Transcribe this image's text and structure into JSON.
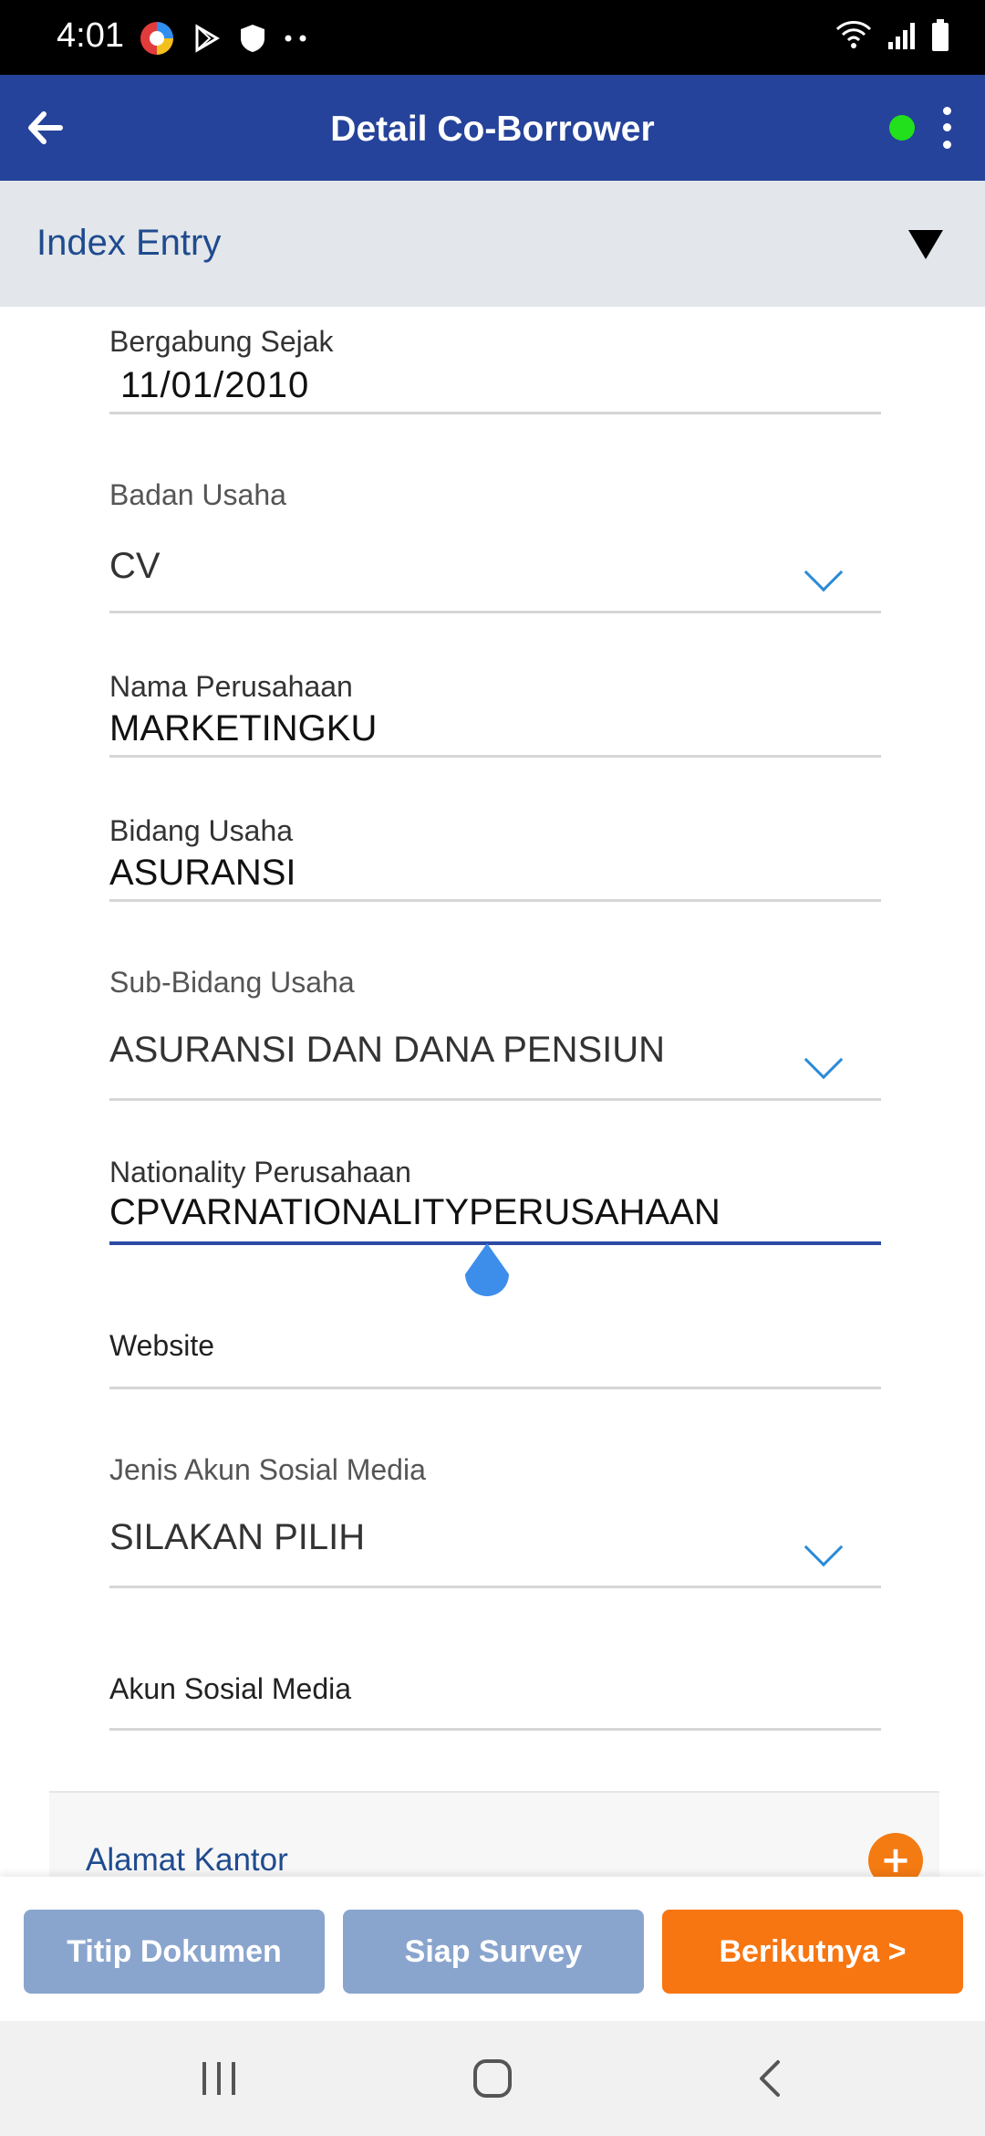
{
  "status_bar": {
    "time": "4:01"
  },
  "app_bar": {
    "title": "Detail Co-Borrower",
    "status_color": "#22e01c"
  },
  "section": {
    "title": "Index Entry"
  },
  "fields": {
    "bergabung_sejak": {
      "label": "Bergabung Sejak",
      "value": "11/01/2010"
    },
    "badan_usaha": {
      "label": "Badan Usaha",
      "value": "CV"
    },
    "nama_perusahaan": {
      "label": "Nama Perusahaan",
      "value": "MARKETINGKU"
    },
    "bidang_usaha": {
      "label": "Bidang Usaha",
      "value": "ASURANSI"
    },
    "sub_bidang_usaha": {
      "label": "Sub-Bidang Usaha",
      "value": "ASURANSI DAN DANA PENSIUN"
    },
    "nationality_perusahaan": {
      "label": "Nationality Perusahaan",
      "value": "CPVARNATIONALITYPERUSAHAAN"
    },
    "website": {
      "label": "Website",
      "value": ""
    },
    "jenis_akun_sosial_media": {
      "label": "Jenis Akun Sosial Media",
      "value": "SILAKAN PILIH"
    },
    "akun_sosial_media": {
      "label": "Akun Sosial Media",
      "value": ""
    }
  },
  "address": {
    "title": "Alamat Kantor",
    "add_label": "+"
  },
  "buttons": {
    "titip_dokumen": "Titip Dokumen",
    "siap_survey": "Siap Survey",
    "berikutnya": "Berikutnya >"
  },
  "colors": {
    "primary": "#25439a",
    "accent": "#f77611",
    "disabled": "#8aa5cd"
  }
}
